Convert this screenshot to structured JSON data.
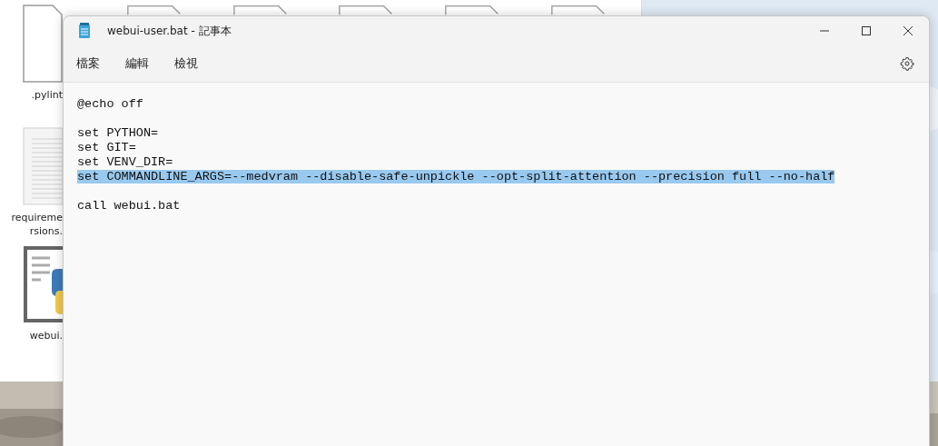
{
  "desktop_files": [
    {
      "label": ".pylint",
      "kind": "blank"
    },
    {
      "label": "requireme\nrsions.",
      "kind": "text"
    },
    {
      "label": "webui.",
      "kind": "python"
    }
  ],
  "window": {
    "title": "webui-user.bat - 記事本"
  },
  "menu": [
    {
      "label": "檔案"
    },
    {
      "label": "編輯"
    },
    {
      "label": "檢視"
    }
  ],
  "lines": [
    {
      "text": "@echo off",
      "selected": false
    },
    {
      "selected": false
    },
    {
      "text": "set PYTHON=",
      "selected": false
    },
    {
      "text": "set GIT=",
      "selected": false
    },
    {
      "text": "set VENV_DIR=",
      "selected": false
    },
    {
      "text": "set COMMANDLINE_ARGS=--medvram --disable-safe-unpickle --opt-split-attention --precision full --no-half",
      "selected": true
    },
    {
      "selected": false
    },
    {
      "text": "call webui.bat",
      "selected": false
    }
  ]
}
